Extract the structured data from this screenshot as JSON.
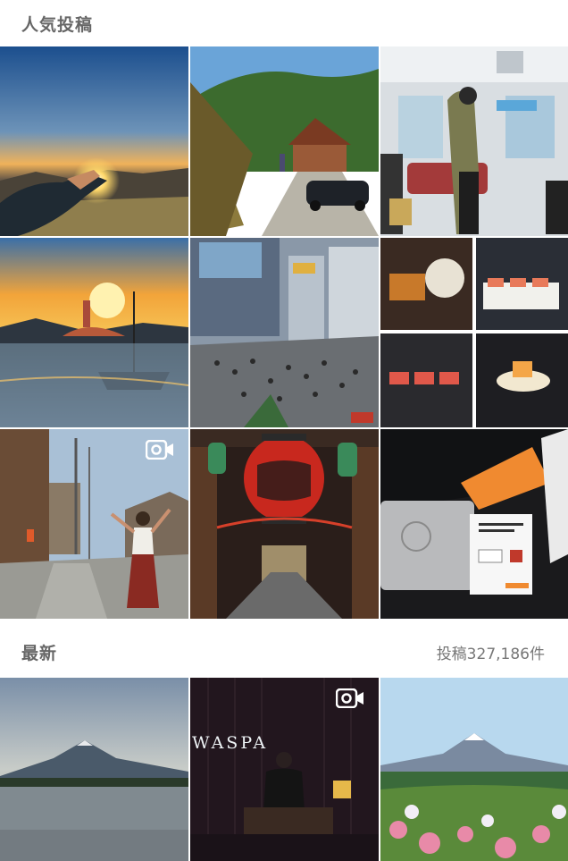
{
  "top_posts": {
    "title": "人気投稿",
    "tiles": [
      {
        "name": "tile-hand-sunset",
        "video": false
      },
      {
        "name": "tile-farmhouse-car",
        "video": false
      },
      {
        "name": "tile-train-interior",
        "video": false
      },
      {
        "name": "tile-lake-sunset-boat",
        "video": false
      },
      {
        "name": "tile-shibuya-crossing",
        "video": false
      },
      {
        "name": "tile-food-collage",
        "video": false
      },
      {
        "name": "tile-street-dance",
        "video": true
      },
      {
        "name": "tile-temple-lantern",
        "video": false
      },
      {
        "name": "tile-passport-ticket",
        "video": false
      }
    ]
  },
  "latest": {
    "title": "最新",
    "count_label": "投稿327,186件",
    "tiles": [
      {
        "name": "tile-fuji-lake",
        "video": false
      },
      {
        "name": "tile-waspa-night",
        "video": true,
        "sign_text": "WASPA"
      },
      {
        "name": "tile-fuji-flowers",
        "video": false
      }
    ]
  },
  "icons": {
    "video": "video-camera-icon"
  }
}
